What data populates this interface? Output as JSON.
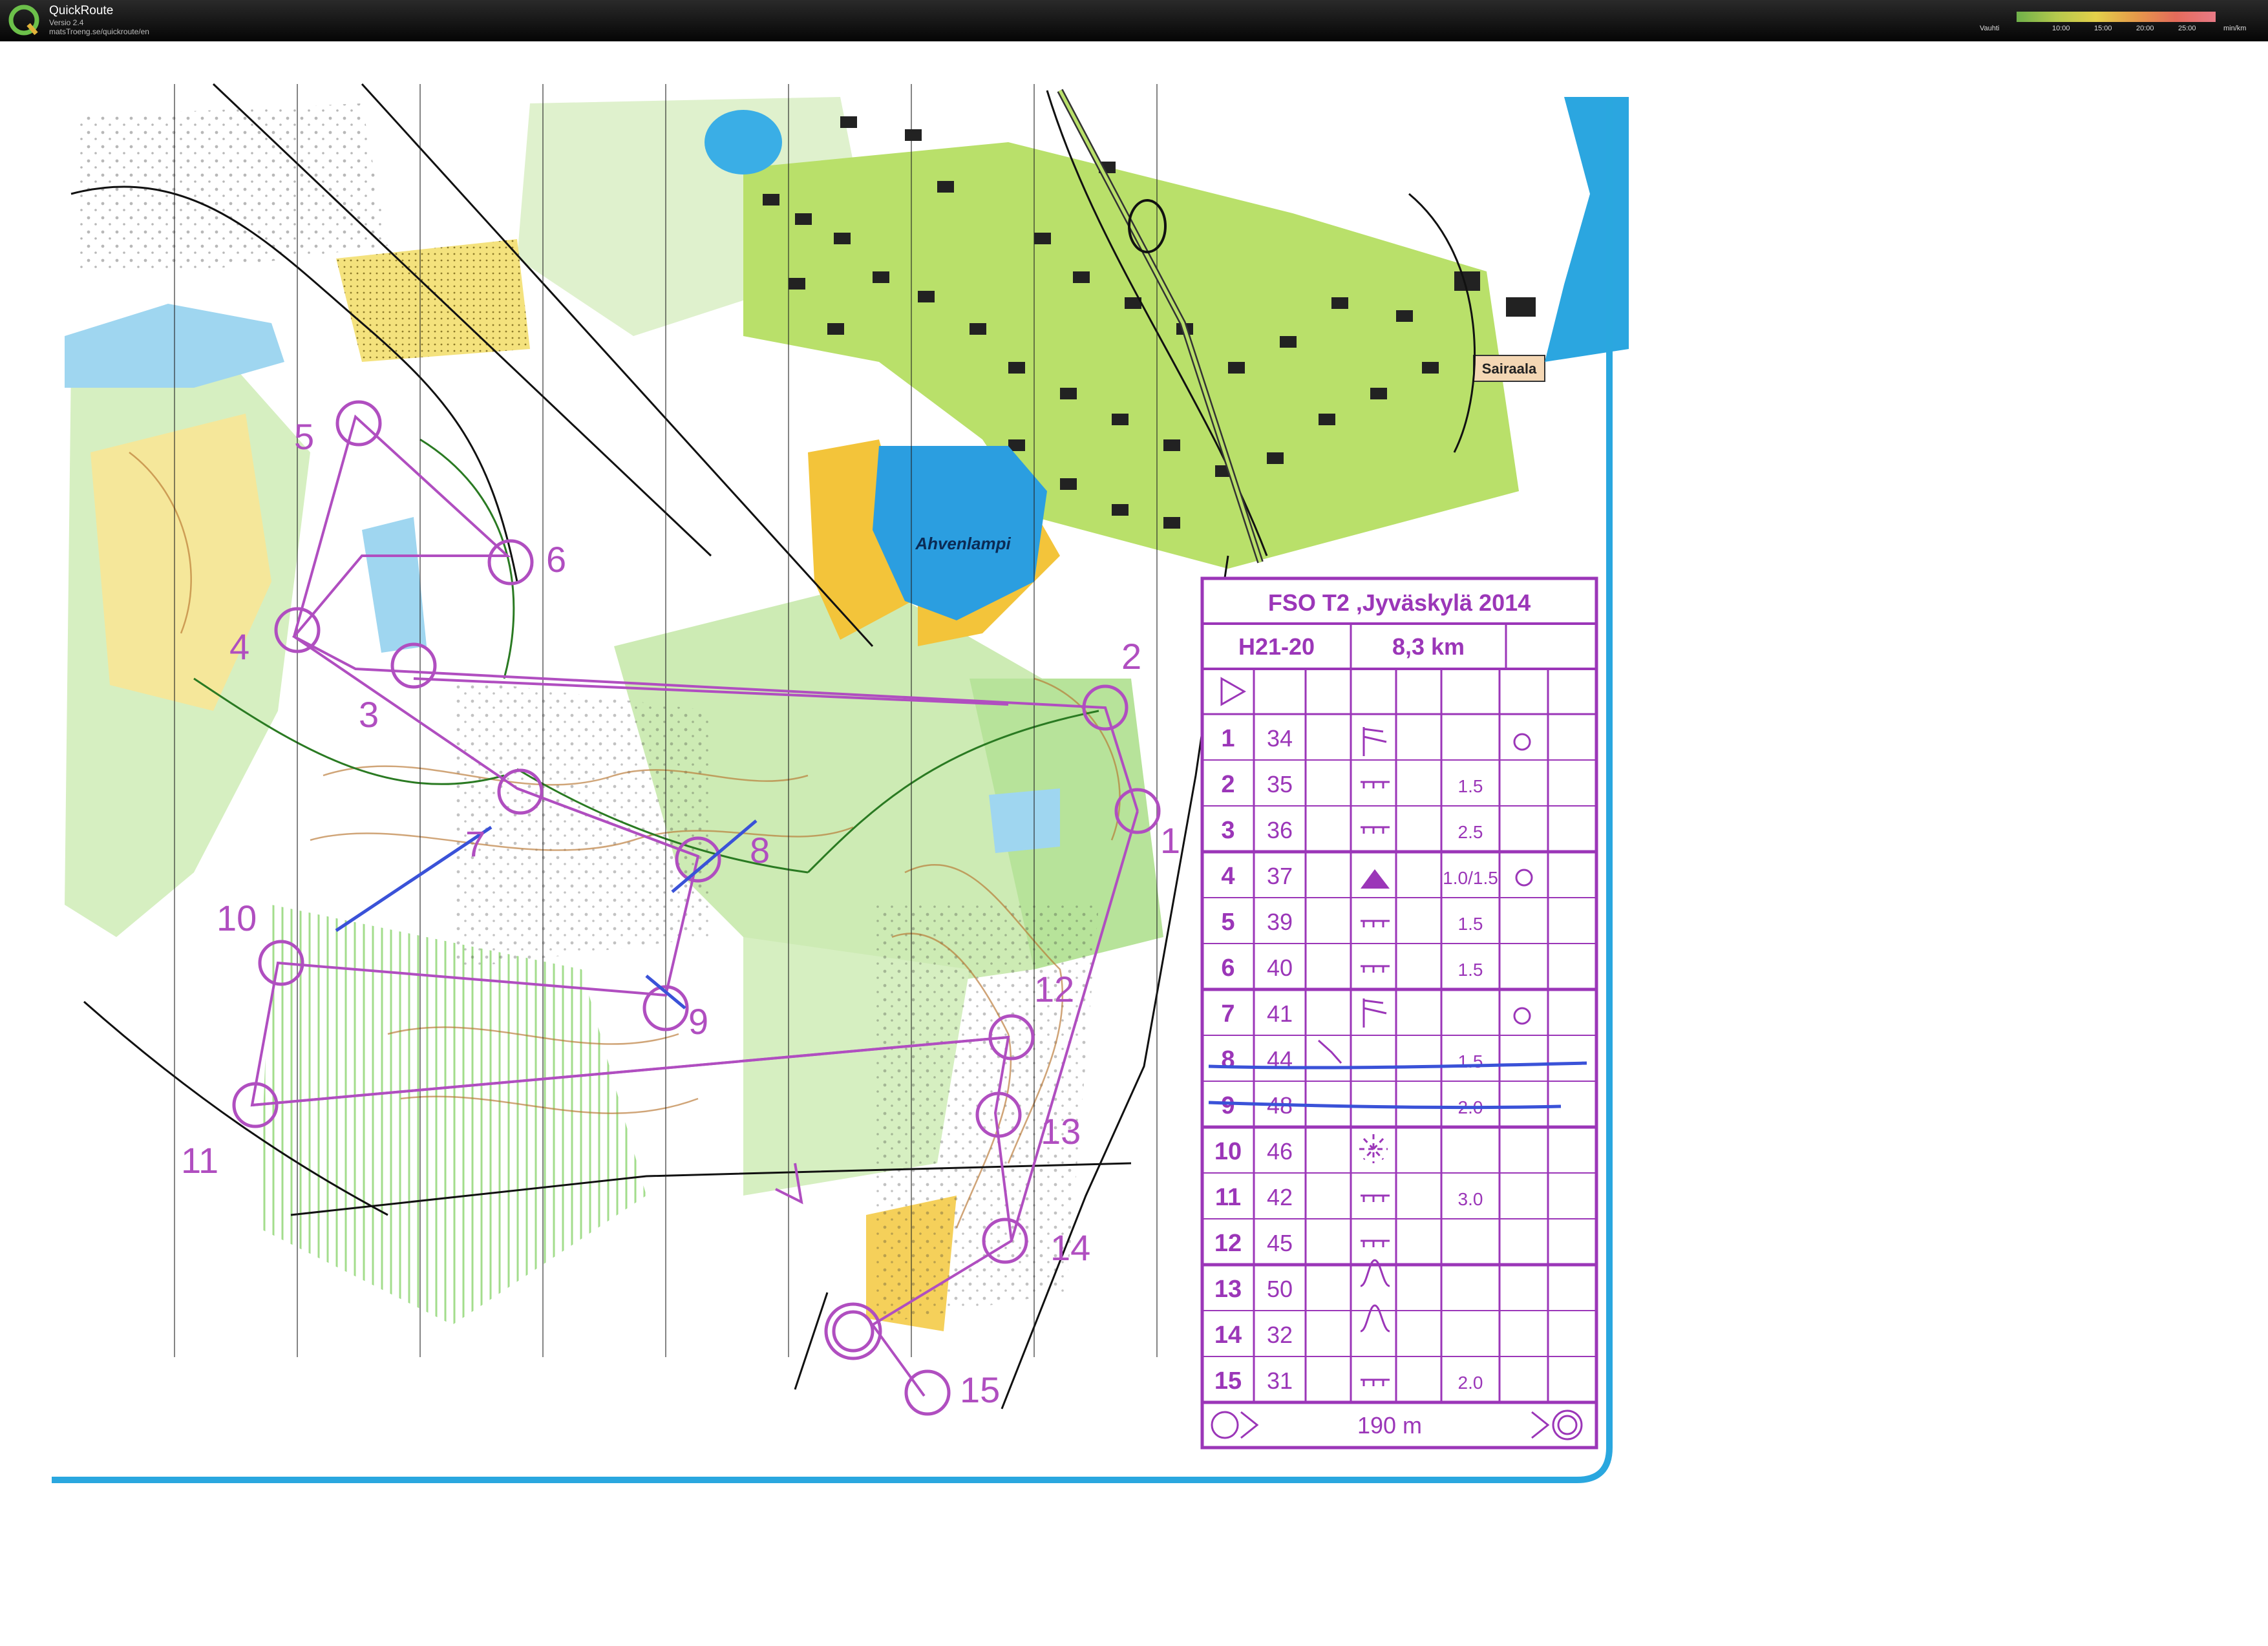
{
  "app": {
    "title": "QuickRoute",
    "version": "Versio 2.4",
    "url": "matsTroeng.se/quickroute/en",
    "pace_legend": {
      "label": "Vauhti",
      "ticks": [
        "10:00",
        "15:00",
        "20:00",
        "25:00"
      ],
      "unit": "min/km",
      "colors": [
        "#6fb04a",
        "#b4c94d",
        "#e4cf4a",
        "#e59a4a",
        "#e46b5b",
        "#e87a86"
      ]
    }
  },
  "map": {
    "place_labels": {
      "lake": "Ahvenlampi",
      "hospital": "Sairaala"
    },
    "course_color": "#b04ec0",
    "control_labels": [
      "2",
      "1",
      "5",
      "6",
      "4",
      "3",
      "7",
      "8",
      "10",
      "9",
      "12",
      "11",
      "13",
      "14",
      "15"
    ]
  },
  "control_description": {
    "title": "FSO T2 ,Jyväskylä 2014",
    "class": "H21-20",
    "length": "8,3 km",
    "rows": [
      {
        "num": "1",
        "code": "34",
        "dim": ""
      },
      {
        "num": "2",
        "code": "35",
        "dim": "1.5"
      },
      {
        "num": "3",
        "code": "36",
        "dim": "2.5"
      },
      {
        "num": "4",
        "code": "37",
        "dim": "1.0/1.5"
      },
      {
        "num": "5",
        "code": "39",
        "dim": "1.5"
      },
      {
        "num": "6",
        "code": "40",
        "dim": "1.5"
      },
      {
        "num": "7",
        "code": "41",
        "dim": ""
      },
      {
        "num": "8",
        "code": "44",
        "dim": "1.5"
      },
      {
        "num": "9",
        "code": "48",
        "dim": "2.0"
      },
      {
        "num": "10",
        "code": "46",
        "dim": ""
      },
      {
        "num": "11",
        "code": "42",
        "dim": "3.0"
      },
      {
        "num": "12",
        "code": "45",
        "dim": ""
      },
      {
        "num": "13",
        "code": "50",
        "dim": ""
      },
      {
        "num": "14",
        "code": "32",
        "dim": ""
      },
      {
        "num": "15",
        "code": "31",
        "dim": "2.0"
      }
    ],
    "finish": "190 m"
  }
}
